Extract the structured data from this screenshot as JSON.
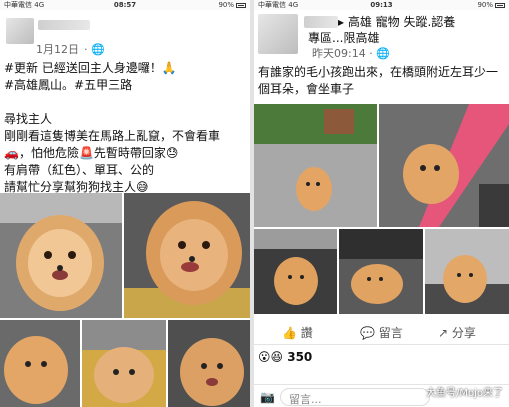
{
  "left": {
    "status": {
      "carrier": "中華電信",
      "network": "4G",
      "time": "08:57",
      "battery": "90%"
    },
    "post": {
      "date": "1月12日",
      "lines": [
        "#更新 已經送回主人身邊囉！🙏",
        "#高雄鳳山。#五甲三路",
        "",
        "尋找主人",
        "剛剛看這隻博美在馬路上亂竄，不會看車",
        "🚗，怕他危險🚨先暫時帶回家😓",
        "有肩帶（紅色）、單耳、公的",
        "請幫忙分享幫狗狗找主人😅"
      ]
    }
  },
  "right": {
    "status": {
      "carrier": "中華電信",
      "network": "4G",
      "time": "09:13",
      "battery": "90%"
    },
    "header": {
      "title_line1": "▸ 高雄 寵物 失蹤.認養",
      "title_line2": "專區...限高雄",
      "time": "昨天09:14 · 🌐"
    },
    "post": {
      "lines": [
        "有誰家的毛小孩跑出來，在橋頭附近左耳少一",
        "個耳朵，會坐車子"
      ]
    },
    "actions": {
      "like": "讚",
      "comment": "留言",
      "share": "分享"
    },
    "reactions": {
      "count": "350"
    },
    "comment_bar": {
      "placeholder": "留言..."
    }
  },
  "watermark": "大鱼号/Mojo来了",
  "colors": {
    "accent": "#4267b2",
    "text": "#111111",
    "muted": "#666666"
  }
}
